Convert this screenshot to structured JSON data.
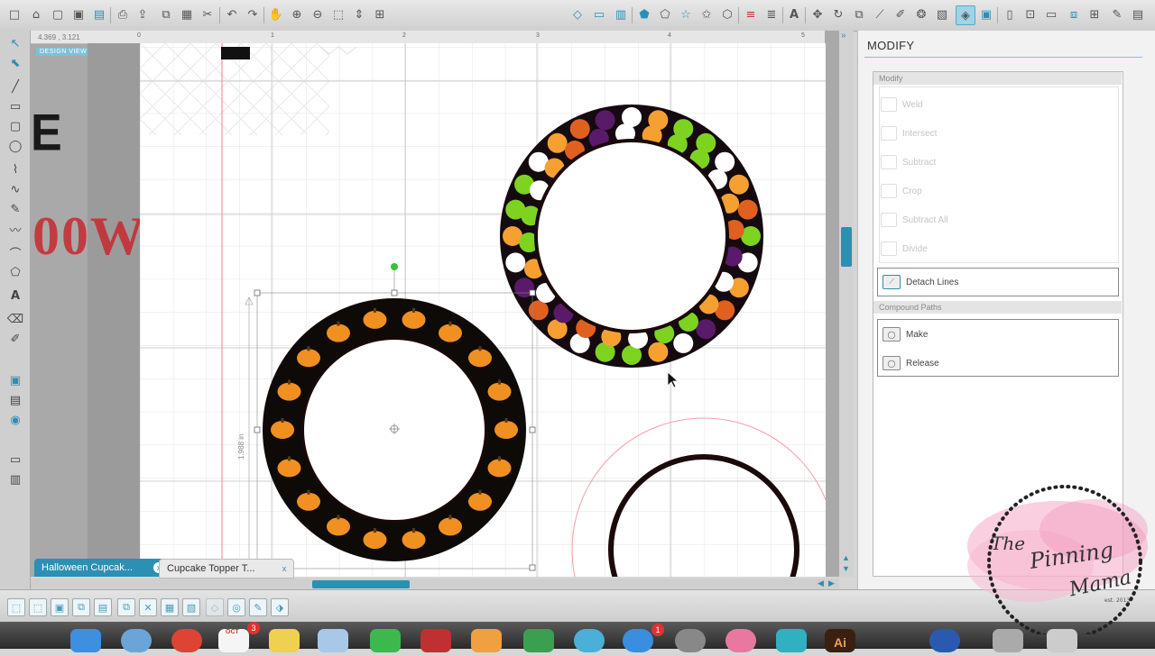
{
  "toolbar": {
    "icons": [
      "new-icon",
      "open-icon",
      "save-icon",
      "save-to-library-icon",
      "print-icon",
      "cut-icon",
      "copy-icon",
      "paste-icon",
      "undo-icon",
      "redo-icon",
      "pan-icon",
      "zoom-in-icon",
      "zoom-out-icon",
      "zoom-fit-icon",
      "move-icon",
      "fill-icon",
      "line-color-icon",
      "line-style-icon",
      "fill-panel-icon",
      "shape-icon",
      "grid-icon",
      "text-style-icon",
      "transform-icon",
      "replicate-icon",
      "modify-icon",
      "offset-icon",
      "trace-icon",
      "store-icon",
      "settings-icon"
    ]
  },
  "coordinates": "4.369 , 3.121",
  "design_view_label": "DESIGN VIEW",
  "ruler_marks": [
    "0",
    "1",
    "2",
    "3",
    "4",
    "5"
  ],
  "canvas_text": {
    "red_letter_e": "E",
    "red_word": "00W"
  },
  "dimension_label": "1.988 in",
  "tabs": [
    {
      "label": "Halloween Cupcak...",
      "close": "x"
    },
    {
      "label": "Cupcake Topper T...",
      "close": "x"
    }
  ],
  "panel": {
    "title": "MODIFY",
    "modify_section": {
      "header": "Modify",
      "items": [
        "Weld",
        "Intersect",
        "Subtract",
        "Crop",
        "Subtract All",
        "Divide"
      ]
    },
    "detach_button": "Detach Lines",
    "compound_section": {
      "header": "Compound Paths",
      "items": [
        "Make",
        "Release"
      ]
    }
  },
  "dock": {
    "calendar_month": "OCT",
    "calendar_badge": "3",
    "store_badge": "1",
    "illustrator_label": "Ai"
  },
  "watermark": {
    "line1": "The",
    "line2": "Pinning",
    "line3": "Mama",
    "line4": "est. 2013"
  },
  "colors": {
    "accent": "#2c8fb4",
    "pumpkin_orange": "#f09020",
    "polka_green": "#7dd320",
    "polka_orange": "#f5a030",
    "polka_darkorange": "#e06020",
    "polka_purple": "#5a1a6a"
  }
}
